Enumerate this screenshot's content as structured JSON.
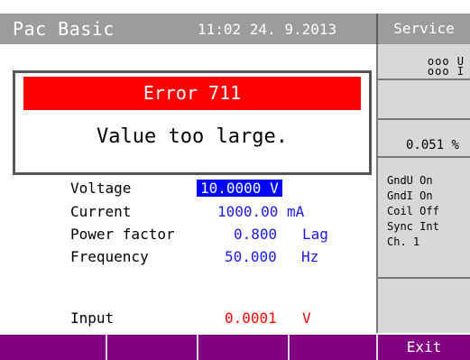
{
  "header": {
    "title": "Pac Basic",
    "datetime": "11:02  24. 9.2013",
    "service_label": "Service"
  },
  "indicators": {
    "voltage_row": "ooo U",
    "current_row": "ooo I",
    "percent": "0.051 %",
    "status": [
      "GndU On",
      "GndI On",
      "Coil Off",
      "Sync Int",
      "Ch. 1"
    ]
  },
  "error": {
    "title": "Error 711",
    "message": "Value too large."
  },
  "params": {
    "voltage": {
      "label": "Voltage",
      "value": "10.0000",
      "unit": "V"
    },
    "current": {
      "label": "Current",
      "value": "1000.00",
      "unit": "mA"
    },
    "power_factor": {
      "label": "Power factor",
      "value": "0.800",
      "unit": "Lag"
    },
    "frequency": {
      "label": "Frequency",
      "value": "50.000",
      "unit": "Hz"
    },
    "input": {
      "label": "Input",
      "value": "0.0001",
      "unit": "V"
    }
  },
  "softkeys": [
    "",
    "",
    "",
    "",
    "Exit"
  ],
  "colors": {
    "titlebar": "#9c9c9c",
    "error_bar": "#ff0000",
    "selected_value_bg": "#0000ff",
    "value_text": "#1a1ae0",
    "input_value_text": "#ff0000",
    "softkey_bar": "#800080"
  }
}
